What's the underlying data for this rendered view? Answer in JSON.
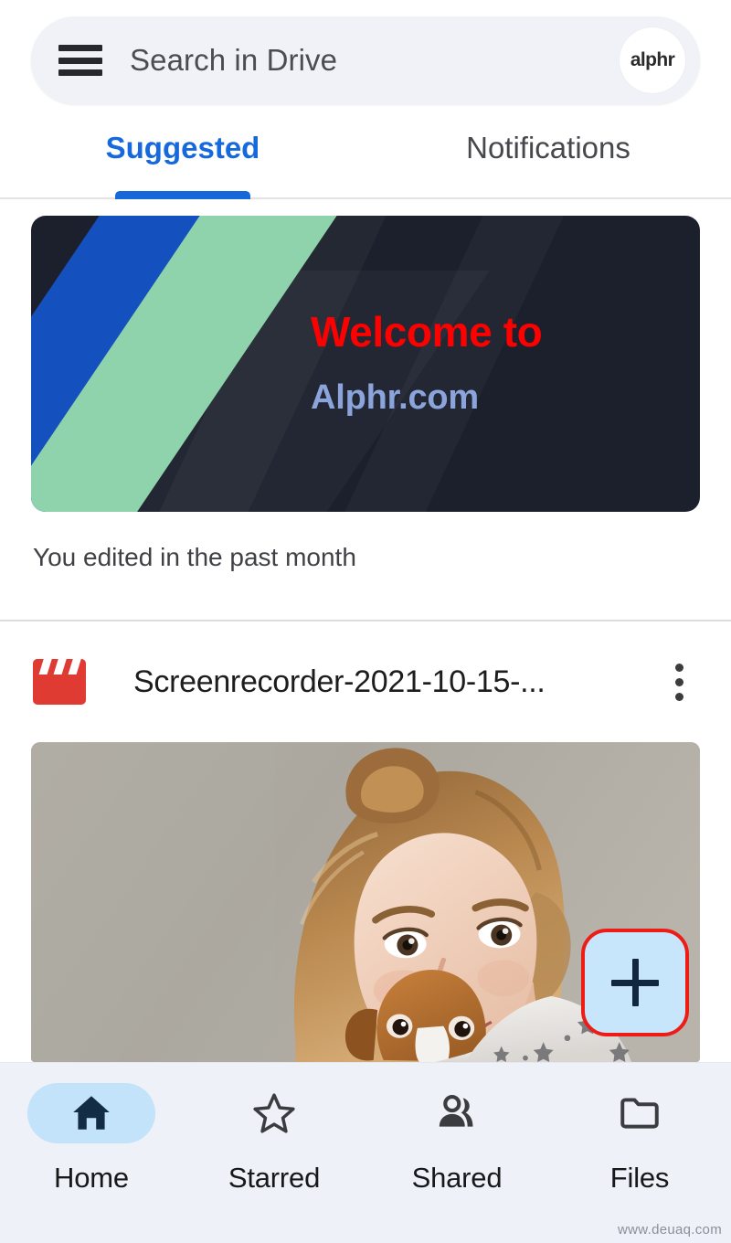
{
  "search": {
    "placeholder": "Search in Drive",
    "menu_icon": "hamburger-menu-icon",
    "avatar_label": "alphr"
  },
  "tabs": [
    {
      "label": "Suggested",
      "active": true
    },
    {
      "label": "Notifications",
      "active": false
    }
  ],
  "suggested": {
    "banner": {
      "title": "Welcome to",
      "subtitle": "Alphr.com",
      "bg_color": "#1b202c",
      "title_color": "#fe0000",
      "subtitle_color": "#8ba4dc",
      "shape_blue_color": "#1550bf",
      "shape_green_color": "#8ed3ab"
    },
    "edited_note": "You edited in the past month"
  },
  "file": {
    "icon": "video-clapperboard-icon",
    "name": "Screenrecorder-2021-10-15-...",
    "overflow_icon": "more-vertical-icon",
    "thumbnail_alt": "girl-with-dog-photo"
  },
  "fab": {
    "icon": "plus-icon",
    "bg_color": "#c7e6fb",
    "highlight_color": "#ee1c16"
  },
  "bottom_nav": [
    {
      "label": "Home",
      "icon": "home-icon",
      "active": true
    },
    {
      "label": "Starred",
      "icon": "star-icon",
      "active": false
    },
    {
      "label": "Shared",
      "icon": "people-icon",
      "active": false
    },
    {
      "label": "Files",
      "icon": "folder-icon",
      "active": false
    }
  ],
  "watermark": "www.deuaq.com"
}
